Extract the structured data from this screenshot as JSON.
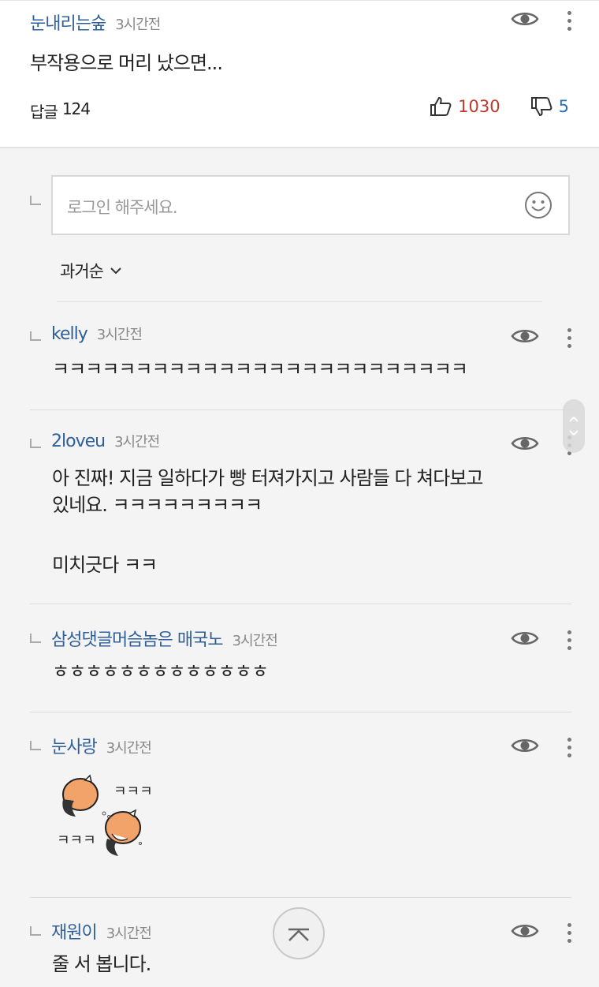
{
  "top_comment": {
    "author": "눈내리는숲",
    "time": "3시간전",
    "body": "부작용으로 머리 났으면...",
    "reply_label": "답글",
    "reply_count": "124",
    "likes": "1030",
    "dislikes": "5"
  },
  "reply_input": {
    "placeholder": "로그인 해주세요."
  },
  "sort": {
    "label": "과거순"
  },
  "replies": [
    {
      "author": "kelly",
      "time": "3시간전",
      "body": "ㅋㅋㅋㅋㅋㅋㅋㅋㅋㅋㅋㅋㅋㅋㅋㅋㅋㅋㅋㅋㅋㅋㅋㅋㅋ"
    },
    {
      "author": "2loveu",
      "time": "3시간전",
      "body_lines": [
        "아 진짜! 지금 일하다가 빵 터져가지고 사람들 다 쳐다보고",
        "있네요. ㅋㅋㅋㅋㅋㅋㅋㅋㅋ",
        "",
        "미치긋다 ㅋㅋ"
      ]
    },
    {
      "author": "삼성댓글머슴놈은 매국노",
      "time": "3시간전",
      "body": "ㅎㅎㅎㅎㅎㅎㅎㅎㅎㅎㅎㅎㅎ"
    },
    {
      "author": "눈사랑",
      "time": "3시간전",
      "sticker_text": [
        "ㅋㅋㅋ",
        "ㅋㅋㅋ"
      ]
    },
    {
      "author": "재원이",
      "time": "3시간전",
      "body": "줄 서 봅니다."
    }
  ],
  "colors": {
    "author": "#2f5f9a",
    "like": "#c0392b",
    "dislike": "#2f6fb3"
  },
  "icons": [
    "eye-icon",
    "more-vertical-icon",
    "thumbs-up-icon",
    "thumbs-down-icon",
    "smiley-icon",
    "chevron-down-icon",
    "chevron-up-icon",
    "reply-arrow-icon"
  ]
}
